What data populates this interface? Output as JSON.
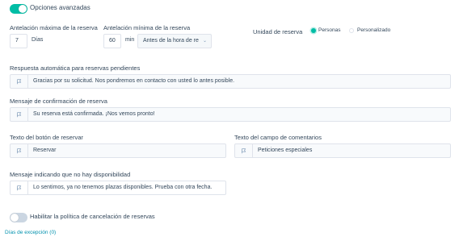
{
  "advanced": {
    "label": "Opciones avanzadas",
    "enabled": true
  },
  "max_advance": {
    "label": "Antelación máxima de la reserva",
    "value": "7",
    "unit": "Días"
  },
  "min_advance": {
    "label": "Antelación mínima de la reserva",
    "value": "60",
    "unit": "min",
    "select_value": "Antes de la hora de re"
  },
  "booking_unit": {
    "label": "Unidad de reserva",
    "options": [
      {
        "label": "Personas",
        "selected": true
      },
      {
        "label": "Personalizado",
        "selected": false
      }
    ]
  },
  "auto_reply": {
    "label": "Respuesta automática para reservas pendientes",
    "value": "Gracias por su solicitud. Nos pondremos en contacto con usted lo antes posible."
  },
  "confirmation": {
    "label": "Mensaje de confirmación de reserva",
    "value": "Su reserva está confirmada. ¡Nos vemos pronto!"
  },
  "book_button": {
    "label": "Texto del botón de reservar",
    "value": "Reservar"
  },
  "comments_field": {
    "label": "Texto del campo de comentarios",
    "value": "Peticiones especiales"
  },
  "no_availability": {
    "label": "Mensaje indicando que no hay disponibilidad",
    "value": "Lo sentimos, ya no tenemos plazas disponibles. Prueba con otra fecha."
  },
  "cancellation": {
    "label": "Habilitar la política de cancelación de reservas",
    "enabled": false
  },
  "exception_days": {
    "label": "Días de excepción (0)"
  },
  "colors": {
    "accent": "#00bda5",
    "link": "#0091ae",
    "text": "#33475b",
    "border": "#dfe3eb"
  },
  "icons": {
    "field_prefix": "flag-icon",
    "select_arrow": "chevron-down-icon"
  }
}
